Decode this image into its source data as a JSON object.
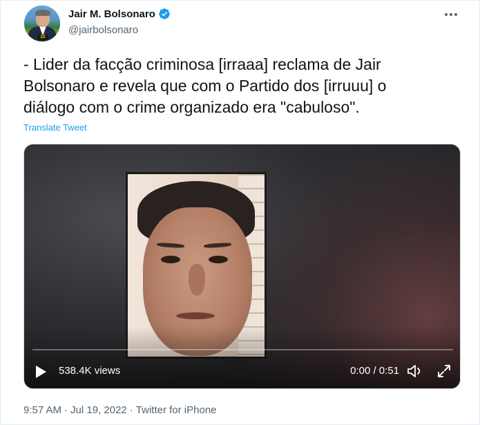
{
  "author": {
    "display_name": "Jair M. Bolsonaro",
    "handle": "@jairbolsonaro",
    "verified_icon": "verified-badge-icon",
    "avatar_badge": "22"
  },
  "tweet": {
    "text": "- Lider da facção criminosa [irraaa] reclama de Jair\nBolsonaro e revela que com o Partido dos [irruuu] o\ndiálogo com o crime organizado era \"cabuloso\".",
    "translate_label": "Translate Tweet"
  },
  "video": {
    "views": "538.4K views",
    "time": "0:00 / 0:51",
    "progress": 0
  },
  "meta": {
    "time": "9:57 AM",
    "separator1": "·",
    "date": "Jul 19, 2022",
    "separator2": "·",
    "source": "Twitter for iPhone"
  },
  "colors": {
    "accent": "#1d9bf0",
    "text_primary": "#0f1419",
    "text_secondary": "#536471"
  }
}
